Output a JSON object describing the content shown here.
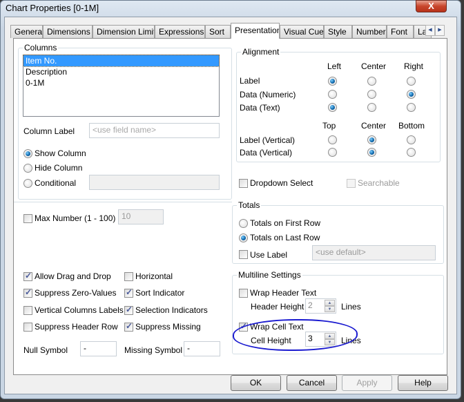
{
  "window": {
    "title": "Chart Properties [0-1M]",
    "close_label": "X"
  },
  "tabs": [
    {
      "label": "General",
      "active": false
    },
    {
      "label": "Dimensions",
      "active": false
    },
    {
      "label": "Dimension Limits",
      "active": false
    },
    {
      "label": "Expressions",
      "active": false
    },
    {
      "label": "Sort",
      "active": false
    },
    {
      "label": "Presentation",
      "active": true
    },
    {
      "label": "Visual Cues",
      "active": false
    },
    {
      "label": "Style",
      "active": false
    },
    {
      "label": "Number",
      "active": false
    },
    {
      "label": "Font",
      "active": false
    },
    {
      "label": "La",
      "active": false
    }
  ],
  "tab_scroll": {
    "left": "◀",
    "right": "▶"
  },
  "columns": {
    "group_label": "Columns",
    "items": [
      "Item No.",
      "Description",
      "0-1M"
    ],
    "selected_index": 0,
    "column_label_text": "Column Label",
    "column_label_placeholder": "<use field name>",
    "visibility_options": [
      {
        "label": "Show Column",
        "checked": true
      },
      {
        "label": "Hide Column",
        "checked": false
      },
      {
        "label": "Conditional",
        "checked": false
      }
    ],
    "conditional_value": ""
  },
  "alignment": {
    "group_label": "Alignment",
    "horizontal_headers": [
      "Left",
      "Center",
      "Right"
    ],
    "horizontal_rows": [
      {
        "label": "Label",
        "selected": "Left"
      },
      {
        "label": "Data (Numeric)",
        "selected": "Right"
      },
      {
        "label": "Data (Text)",
        "selected": "Left"
      }
    ],
    "vertical_headers": [
      "Top",
      "Center",
      "Bottom"
    ],
    "vertical_rows": [
      {
        "label": "Label (Vertical)",
        "selected": "Center"
      },
      {
        "label": "Data (Vertical)",
        "selected": "Center"
      }
    ]
  },
  "dropdown_select": {
    "label": "Dropdown Select",
    "checked": false
  },
  "searchable": {
    "label": "Searchable",
    "checked": false,
    "disabled": true
  },
  "max_number": {
    "label": "Max Number (1 - 100)",
    "checked": false,
    "value": "10"
  },
  "options_left": [
    {
      "label": "Allow Drag and Drop",
      "checked": true
    },
    {
      "label": "Suppress Zero-Values",
      "checked": true
    },
    {
      "label": "Vertical Columns Labels",
      "checked": false
    },
    {
      "label": "Suppress Header Row",
      "checked": false
    }
  ],
  "options_right": [
    {
      "label": "Horizontal",
      "checked": false
    },
    {
      "label": "Sort Indicator",
      "checked": true
    },
    {
      "label": "Selection Indicators",
      "checked": true
    },
    {
      "label": "Suppress Missing",
      "checked": true
    }
  ],
  "null_symbol": {
    "label": "Null Symbol",
    "value": "-"
  },
  "missing_symbol": {
    "label": "Missing Symbol",
    "value": "-"
  },
  "totals": {
    "group_label": "Totals",
    "options": [
      {
        "label": "Totals on First Row",
        "checked": false
      },
      {
        "label": "Totals on Last Row",
        "checked": true
      }
    ],
    "use_label": {
      "label": "Use Label",
      "checked": false
    },
    "label_placeholder": "<use default>"
  },
  "multiline": {
    "group_label": "Multiline Settings",
    "wrap_header": {
      "label": "Wrap Header Text",
      "checked": false
    },
    "header_height": {
      "label": "Header Height",
      "value": "2",
      "unit": "Lines"
    },
    "wrap_cell": {
      "label": "Wrap Cell Text",
      "checked": true
    },
    "cell_height": {
      "label": "Cell Height",
      "value": "3",
      "unit": "Lines"
    }
  },
  "buttons": {
    "ok": "OK",
    "cancel": "Cancel",
    "apply": "Apply",
    "help": "Help"
  },
  "annotation_color": "#1a1ad0"
}
